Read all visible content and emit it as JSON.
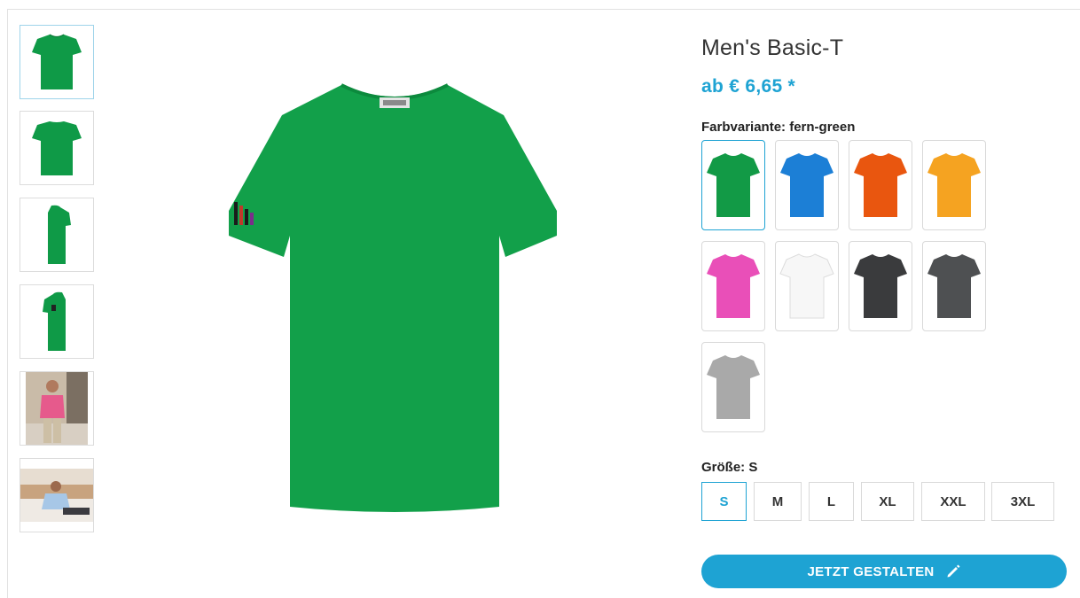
{
  "product": {
    "title": "Men's Basic-T",
    "price": "ab € 6,65 *"
  },
  "thumbnails": [
    {
      "name": "thumb-front",
      "kind": "front",
      "color": "#0f9a47"
    },
    {
      "name": "thumb-back",
      "kind": "back",
      "color": "#0f9a47"
    },
    {
      "name": "thumb-side-right",
      "kind": "side",
      "color": "#0f9a47"
    },
    {
      "name": "thumb-side-left",
      "kind": "side-logo",
      "color": "#0f9a47"
    },
    {
      "name": "thumb-model-pink",
      "kind": "photo-pink"
    },
    {
      "name": "thumb-model-blue",
      "kind": "photo-blue"
    }
  ],
  "color": {
    "label": "Farbvariante: fern-green",
    "selected": "fern-green",
    "swatches": [
      {
        "color": "#129a46"
      },
      {
        "color": "#1c7fd6"
      },
      {
        "color": "#e9560f"
      },
      {
        "color": "#f5a321"
      },
      {
        "color": "#e94fb8"
      },
      {
        "color": "#f7f7f7"
      },
      {
        "color": "#3a3b3d"
      },
      {
        "color": "#4e5052"
      },
      {
        "color": "#a9a9a9"
      }
    ]
  },
  "size": {
    "label": "Größe: S",
    "options": [
      "S",
      "M",
      "L",
      "XL",
      "XXL",
      "3XL"
    ],
    "selected": "S"
  },
  "cta": {
    "label": "JETZT GESTALTEN"
  },
  "colors": {
    "accent": "#1ea3d3",
    "shirt": "#12a04a"
  }
}
